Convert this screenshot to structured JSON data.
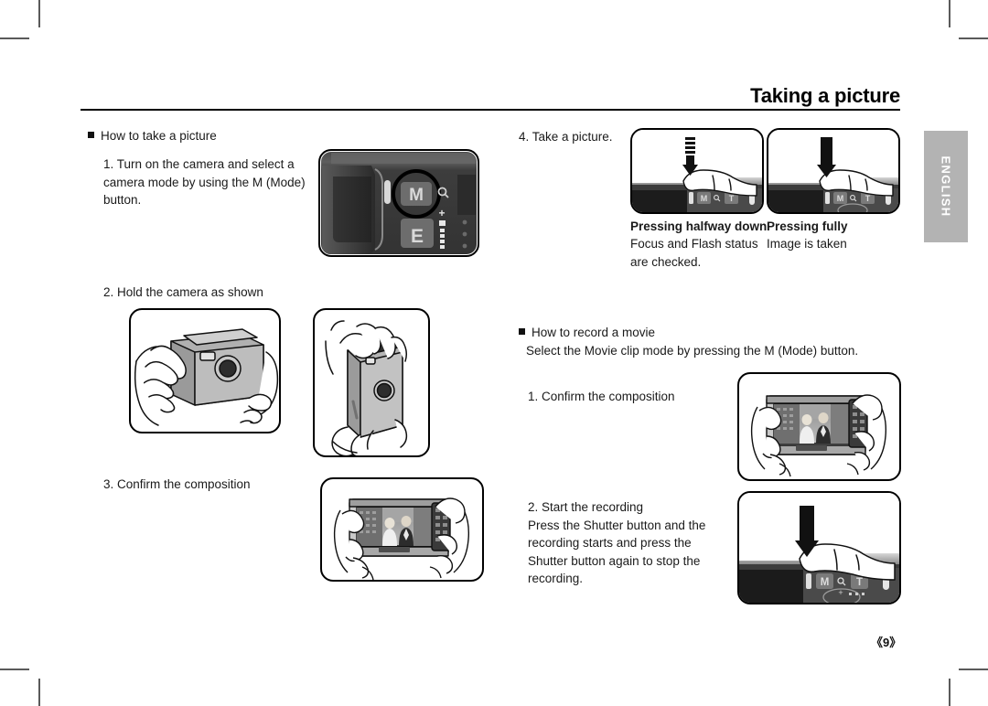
{
  "document": {
    "title": "Taking a picture",
    "language_tab": "ENGLISH",
    "page_number": "《9》"
  },
  "left_column": {
    "section_heading": "How to take a picture",
    "step1": "1. Turn on the camera and select a\n    camera mode by using the M (Mode)\n    button.",
    "step2": "2. Hold the camera as shown",
    "step3": "3. Confirm the composition",
    "camera_back_labels": {
      "mode_button": "M",
      "effect_button": "E",
      "zoom_icon": "magnifier-icon",
      "zoom_plus": "+"
    }
  },
  "right_column": {
    "step4": "4. Take a picture.",
    "caption_half_title": "Pressing halfway down",
    "caption_half_body": "Focus and Flash status\nare checked.",
    "caption_full_title": "Pressing fully",
    "caption_full_body": "Image is taken",
    "movie_heading": "How to record a movie",
    "movie_intro": "Select the Movie clip mode by pressing the M (Mode) button.",
    "movie_step1": "1. Confirm the composition",
    "movie_step2": "2. Start the recording\n    Press the Shutter button and the\n    recording starts and press the\n    Shutter button again to stop the\n    recording.",
    "camera_top_labels": {
      "mode_button": "M",
      "zoom_icon": "magnifier-icon",
      "tele_button": "T"
    }
  },
  "colors": {
    "ink": "#1a1a1a",
    "rule": "#000000",
    "tab_bg": "#b3b3b3",
    "tab_text": "#ffffff",
    "camera_dark": "#3a3a3a",
    "camera_mid": "#6e6e6e",
    "camera_light": "#b9b9b9",
    "crop_mark": "#5a5a5a"
  }
}
